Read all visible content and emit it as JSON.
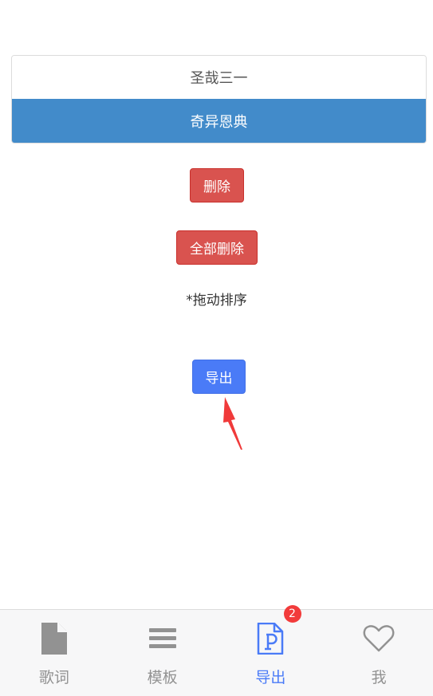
{
  "song_list": {
    "items": [
      {
        "label": "圣哉三一",
        "active": false
      },
      {
        "label": "奇异恩典",
        "active": true
      }
    ]
  },
  "actions": {
    "delete_label": "删除",
    "delete_all_label": "全部删除",
    "sort_hint": "*拖动排序",
    "export_label": "导出"
  },
  "tabbar": {
    "tabs": [
      {
        "label": "歌词",
        "icon": "file-icon",
        "active": false
      },
      {
        "label": "模板",
        "icon": "menu-lines-icon",
        "active": false
      },
      {
        "label": "导出",
        "icon": "ppt-file-icon",
        "active": true,
        "badge": "2"
      },
      {
        "label": "我",
        "icon": "heart-icon",
        "active": false
      }
    ]
  },
  "colors": {
    "primary": "#4a7bf7",
    "active_item": "#428bca",
    "danger": "#d9534f",
    "badge": "#f23b3b",
    "annotation_arrow": "#f03a3a"
  }
}
